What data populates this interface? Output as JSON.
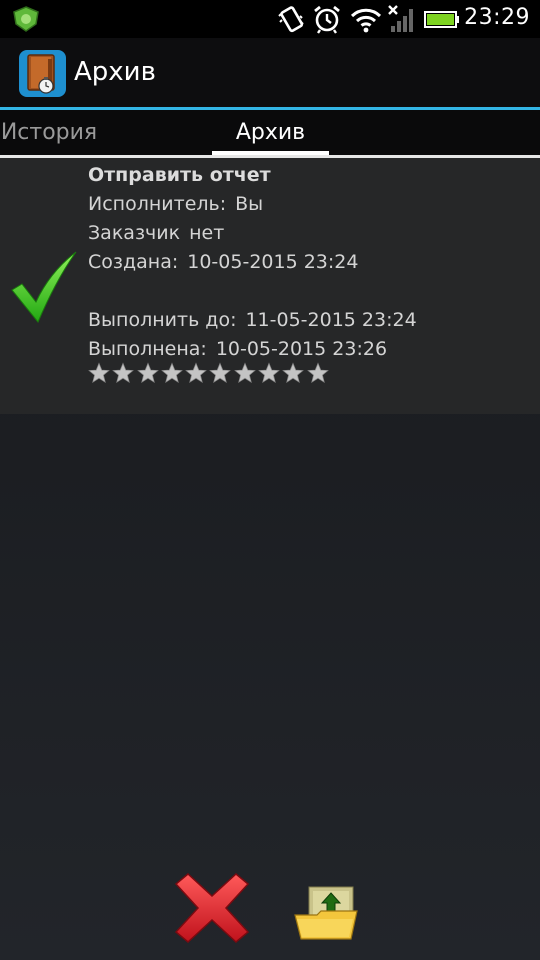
{
  "status_bar": {
    "time": "23:29",
    "icons": [
      "security-shield-icon",
      "vibrate-icon",
      "alarm-clock-icon",
      "wifi-icon",
      "no-signal-icon",
      "battery-icon"
    ]
  },
  "action_bar": {
    "title": "Архив",
    "icon": "archive-book-icon"
  },
  "tabs": [
    {
      "label": "История",
      "selected": false
    },
    {
      "label": "Архив",
      "selected": true
    }
  ],
  "task": {
    "title": "Отправить отчет",
    "executor": {
      "label": "Исполнитель:",
      "value": "Вы"
    },
    "customer": {
      "label": "Заказчик",
      "value": "нет"
    },
    "created": {
      "label": "Создана:",
      "value": "10-05-2015 23:24"
    },
    "due": {
      "label": "Выполнить до:",
      "value": "11-05-2015 23:24"
    },
    "completed": {
      "label": "Выполнена:",
      "value": "10-05-2015 23:26"
    },
    "rating": {
      "value": 0,
      "max": 10
    },
    "status_icon": "checkmark-icon"
  },
  "toolbar": {
    "delete_icon": "red-x-delete-icon",
    "restore_icon": "folder-upload-icon"
  },
  "colors": {
    "accent": "#33b5e5",
    "check": "#3fcf2a",
    "delete": "#e0202a"
  }
}
